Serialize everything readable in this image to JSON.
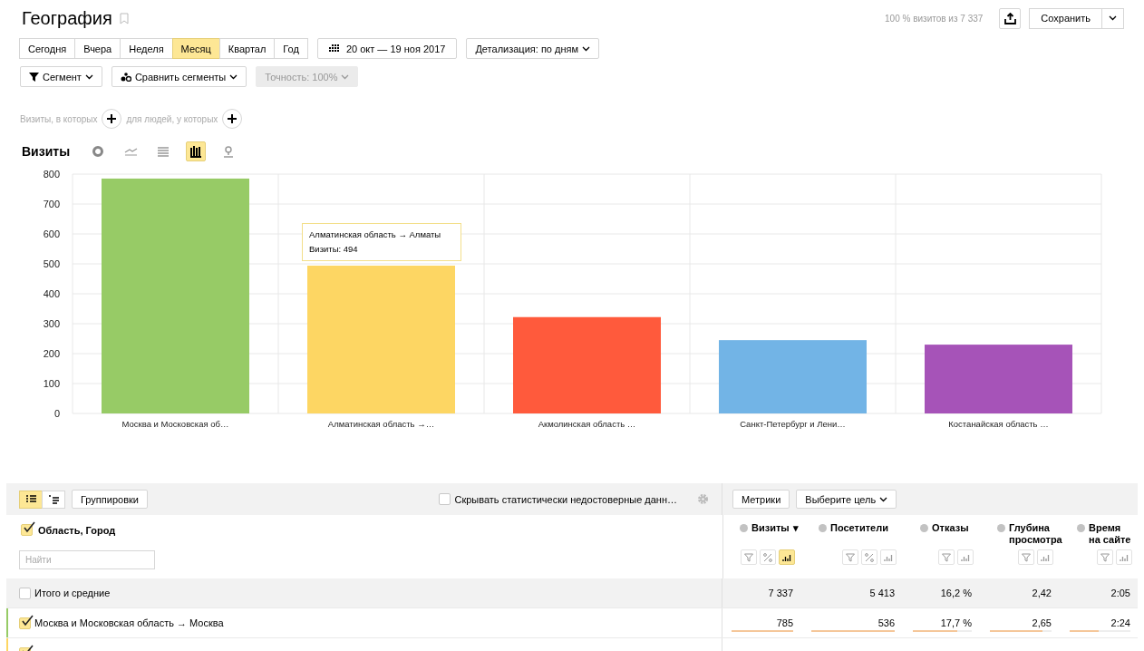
{
  "header": {
    "title": "География",
    "summary": "100 % визитов из 7 337",
    "save_label": "Сохранить"
  },
  "periods": [
    {
      "label": "Сегодня",
      "selected": false
    },
    {
      "label": "Вчера",
      "selected": false
    },
    {
      "label": "Неделя",
      "selected": false
    },
    {
      "label": "Месяц",
      "selected": true
    },
    {
      "label": "Квартал",
      "selected": false
    },
    {
      "label": "Год",
      "selected": false
    }
  ],
  "date_range": "20 окт — 19 ноя 2017",
  "detail": "Детализация: по дням",
  "segment": "Сегмент",
  "compare": "Сравнить сегменты",
  "accuracy": {
    "label": "Точность: 100%",
    "disabled": true
  },
  "conditions": [
    "Визиты, в которых",
    "для людей, у которых"
  ],
  "chart_section": {
    "title": "Визиты",
    "chart_types": [
      {
        "kind": "pie",
        "selected": false
      },
      {
        "kind": "line",
        "selected": false
      },
      {
        "kind": "area",
        "selected": false
      },
      {
        "kind": "bar",
        "selected": true
      },
      {
        "kind": "map",
        "selected": false
      }
    ]
  },
  "chart_data": {
    "type": "bar",
    "categories": [
      "Москва и Московская об…",
      "Алматинская область →…",
      "Акмолинская область …",
      "Санкт-Петербург и Лени…",
      "Костанайская область …"
    ],
    "values": [
      785,
      494,
      322,
      245,
      230
    ],
    "grid": true,
    "colors": [
      "#97cb66",
      "#fdd663",
      "#ff5a3c",
      "#72b4e6",
      "#a653b8"
    ],
    "ylim": [
      0,
      800
    ],
    "yticks": [
      0,
      100,
      200,
      300,
      400,
      500,
      600,
      700,
      800
    ]
  },
  "tooltip": {
    "title": "Алматинская область → Алматы",
    "text": "Визиты: 494"
  },
  "table": {
    "views": [
      {
        "kind": "list",
        "selected": true
      },
      {
        "kind": "tree",
        "selected": false
      }
    ],
    "groupings": "Группировки",
    "hide_unreliable": {
      "label": "Скрывать статистически недостоверные данн…",
      "checked": false
    },
    "metrics_button": "Метрики",
    "goal_button": "Выберите цель",
    "dimension": {
      "label": "Область, Город",
      "checked": true
    },
    "search": {
      "placeholder": "Найти"
    },
    "columns": [
      {
        "label": "Визиты",
        "sort_indicator": "▾",
        "tools": [
          {
            "kind": "filter",
            "selected": false
          },
          {
            "kind": "percent",
            "selected": false
          },
          {
            "kind": "bars",
            "selected": true
          }
        ]
      },
      {
        "label": "Посетители",
        "tools": [
          {
            "kind": "filter",
            "selected": false
          },
          {
            "kind": "percent",
            "selected": false
          },
          {
            "kind": "bars",
            "selected": false
          }
        ]
      },
      {
        "label": "Отказы",
        "tools": [
          {
            "kind": "filter",
            "selected": false
          },
          {
            "kind": "bars",
            "selected": false
          }
        ]
      },
      {
        "label": "Глубина просмотра",
        "tools": [
          {
            "kind": "filter",
            "selected": false
          },
          {
            "kind": "bars",
            "selected": false
          }
        ]
      },
      {
        "label": "Время на сайте",
        "tools": [
          {
            "kind": "filter",
            "selected": false
          },
          {
            "kind": "bars",
            "selected": false
          }
        ]
      }
    ],
    "totals": {
      "label": "Итого и средние",
      "checked": false,
      "values": [
        "7 337",
        "5 413",
        "16,2 %",
        "2,42",
        "2:05"
      ]
    },
    "rows": [
      {
        "label": "Москва и Московская область → Москва",
        "checked": true,
        "color": "#97cb66",
        "cells": [
          {
            "text": "785",
            "level": 1
          },
          {
            "text": "536",
            "level": 1
          },
          {
            "text": "17,7 %",
            "level": 0.75
          },
          {
            "text": "2,65",
            "level": 0.85
          },
          {
            "text": "2:24",
            "level": 0.48
          }
        ]
      },
      {
        "checked": true,
        "color": "#fdd663"
      }
    ]
  }
}
